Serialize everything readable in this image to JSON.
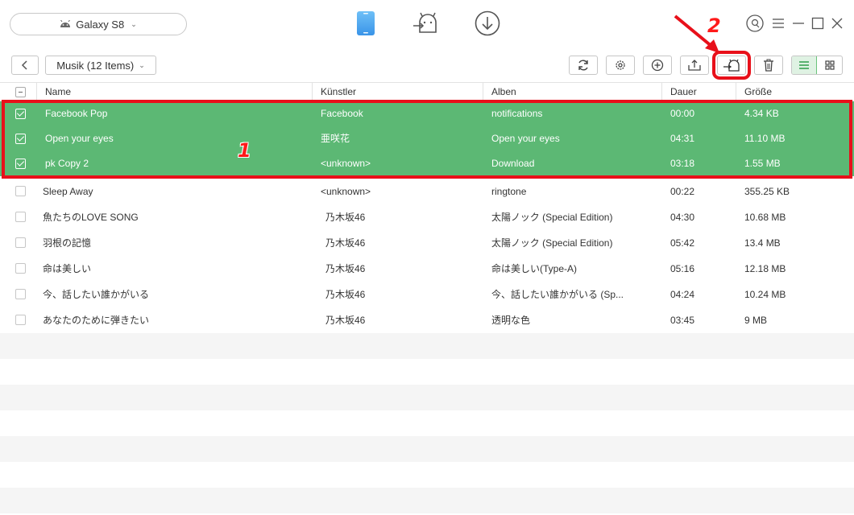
{
  "device": {
    "name": "Galaxy S8",
    "icon": "android-icon"
  },
  "modes": [
    {
      "name": "phone-manager-icon",
      "active": true
    },
    {
      "name": "android-mover-icon",
      "active": false
    },
    {
      "name": "download-icon",
      "active": false
    }
  ],
  "toolbar": {
    "category": "Musik (12 Items)",
    "buttons": [
      "refresh-icon",
      "settings-icon",
      "add-icon",
      "export-to-computer-icon",
      "transfer-to-device-icon",
      "delete-icon"
    ]
  },
  "annotations": {
    "one": "1",
    "two": "2"
  },
  "table": {
    "columns": [
      "Name",
      "Künstler",
      "Alben",
      "Dauer",
      "Größe"
    ],
    "rows": [
      {
        "name": "Facebook Pop",
        "artist": "Facebook",
        "album": "notifications",
        "duration": "00:00",
        "size": "4.34 KB",
        "selected": true
      },
      {
        "name": "Open your eyes",
        "artist": "亜咲花",
        "album": "Open your eyes",
        "duration": "04:31",
        "size": "11.10 MB",
        "selected": true
      },
      {
        "name": "pk Copy 2",
        "artist": "<unknown>",
        "album": "Download",
        "duration": "03:18",
        "size": "1.55 MB",
        "selected": true
      },
      {
        "name": "Sleep Away",
        "artist": "<unknown>",
        "album": "ringtone",
        "duration": "00:22",
        "size": "355.25 KB",
        "selected": false
      },
      {
        "name": "魚たちのLOVE SONG",
        "artist": "乃木坂46",
        "album": "太陽ノック (Special Edition)",
        "duration": "04:30",
        "size": "10.68 MB",
        "selected": false
      },
      {
        "name": "羽根の記憶",
        "artist": "乃木坂46",
        "album": "太陽ノック (Special Edition)",
        "duration": "05:42",
        "size": "13.4 MB",
        "selected": false
      },
      {
        "name": "命は美しい",
        "artist": "乃木坂46",
        "album": "命は美しい(Type-A)",
        "duration": "05:16",
        "size": "12.18 MB",
        "selected": false
      },
      {
        "name": "今、話したい誰かがいる",
        "artist": "乃木坂46",
        "album": "今、話したい誰かがいる (Sp...",
        "duration": "04:24",
        "size": "10.24 MB",
        "selected": false
      },
      {
        "name": "あなたのために弾きたい",
        "artist": "乃木坂46",
        "album": "透明な色",
        "duration": "03:45",
        "size": "9 MB",
        "selected": false
      }
    ]
  },
  "colors": {
    "selected_row": "#5cb874",
    "annotation": "#e8101a",
    "accent_blue": "#4aa3f0"
  }
}
